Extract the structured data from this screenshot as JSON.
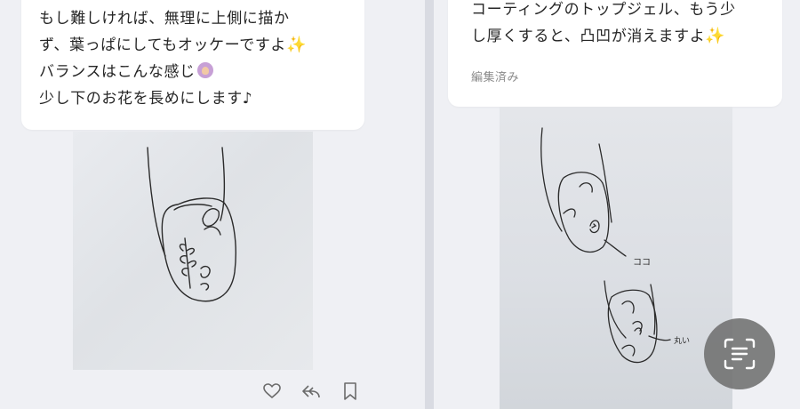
{
  "left_message": {
    "lines": [
      "もし難しければ、無理に上側に描か",
      "ず、葉っぱにしてもオッケーですよ",
      "バランスはこんな感じ",
      "少し下のお花を長めにします♪"
    ],
    "emoji_1": "✨",
    "emoji_3": "woman-emoji"
  },
  "right_message": {
    "lines": [
      "コーティングのトップジェル、もう少",
      "し厚くすると、凸凹が消えますよ"
    ],
    "emoji_2": "✨",
    "edited_label": "編集済み"
  },
  "right_sketch": {
    "annotation_top": "ココ",
    "annotation_bottom": "丸い"
  },
  "actions": {
    "like_icon": "heart-outline-icon",
    "reply_icon": "reply-arrow-icon",
    "bookmark_icon": "bookmark-outline-icon"
  },
  "scan_button": {
    "icon": "text-scan-icon"
  },
  "colors": {
    "background": "#eff0f4",
    "bubble": "#ffffff",
    "scan_button": "#707070",
    "sparkle": "#f2c94c"
  }
}
